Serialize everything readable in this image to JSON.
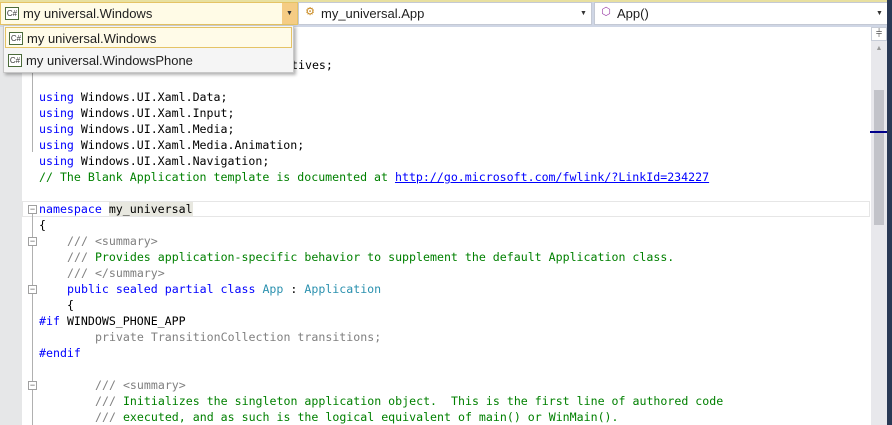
{
  "navbar": {
    "project_dropdown": {
      "value": "my universal.Windows",
      "icon": "csharp-project-icon"
    },
    "type_dropdown": {
      "value": "my_universal.App",
      "icon": "class-icon"
    },
    "member_dropdown": {
      "value": "App()",
      "icon": "method-icon"
    },
    "project_options": [
      "my universal.Windows",
      "my universal.WindowsPhone"
    ],
    "csharp_badge": "C#"
  },
  "code": {
    "l1_tail": "tives;",
    "usings": [
      "Windows.UI.Xaml.Data;",
      "Windows.UI.Xaml.Input;",
      "Windows.UI.Xaml.Media;",
      "Windows.UI.Xaml.Media.Animation;",
      "Windows.UI.Xaml.Navigation;"
    ],
    "using_kw": "using",
    "comment": "// The Blank Application template is documented at ",
    "link": "http://go.microsoft.com/fwlink/?LinkId=234227",
    "namespace_kw": "namespace",
    "namespace_name": "my_universal",
    "open_brace": "{",
    "doc_prefix": "///",
    "summary_open": "<summary>",
    "summary_close": "</summary>",
    "doc1": "Provides application-specific behavior to supplement the default Application class.",
    "class_kw": "public sealed partial class",
    "class_name": "App",
    "colon": ":",
    "base_class": "Application",
    "if_kw": "#if",
    "if_symbol": "WINDOWS_PHONE_APP",
    "inactive_line": "private TransitionCollection transitions;",
    "endif_kw": "#endif",
    "doc2": "Initializes the singleton application object.  This is the first line of authored code",
    "doc3": "executed, and as such is the logical equivalent of main() or WinMain()."
  },
  "colors": {
    "keyword": "#0000ff",
    "comment": "#008000",
    "type": "#2b91af",
    "accent": "#f5cc84"
  }
}
